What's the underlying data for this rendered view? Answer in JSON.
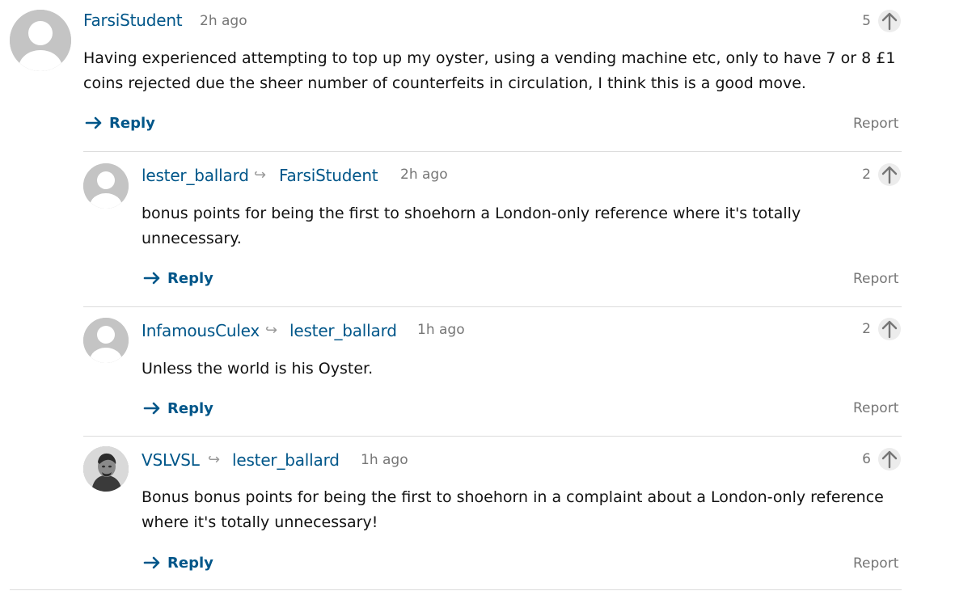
{
  "comments": [
    {
      "author": "FarsiStudent",
      "reply_to": "",
      "timestamp": "2h ago",
      "votes": "5",
      "body": "Having experienced attempting to top up my oyster, using a vending machine etc, only to have 7 or 8 £1 coins rejected due the sheer number of counterfeits in circulation, I think this is a good move.",
      "reply_label": "Reply",
      "report_label": "Report",
      "avatar": "default-avatar"
    },
    {
      "author": "lester_ballard",
      "reply_to": "FarsiStudent",
      "timestamp": "2h ago",
      "votes": "2",
      "body": "bonus points for being the first to shoehorn a London-only reference where it's totally unnecessary.",
      "reply_label": "Reply",
      "report_label": "Report",
      "avatar": "default-avatar"
    },
    {
      "author": "InfamousCulex",
      "reply_to": "lester_ballard",
      "timestamp": "1h ago",
      "votes": "2",
      "body": "Unless the world is his Oyster.",
      "reply_label": "Reply",
      "report_label": "Report",
      "avatar": "default-avatar"
    },
    {
      "author": "VSLVSL",
      "reply_to": "lester_ballard",
      "timestamp": "1h ago",
      "votes": "6",
      "body": "Bonus bonus points for being the first to shoehorn in a complaint about a London-only reference where it's totally unnecessary!",
      "reply_label": "Reply",
      "report_label": "Report",
      "avatar": "photo-avatar"
    }
  ],
  "colors": {
    "link": "#005689",
    "meta": "#767676",
    "text": "#121212",
    "divider": "#dcdcdc"
  }
}
